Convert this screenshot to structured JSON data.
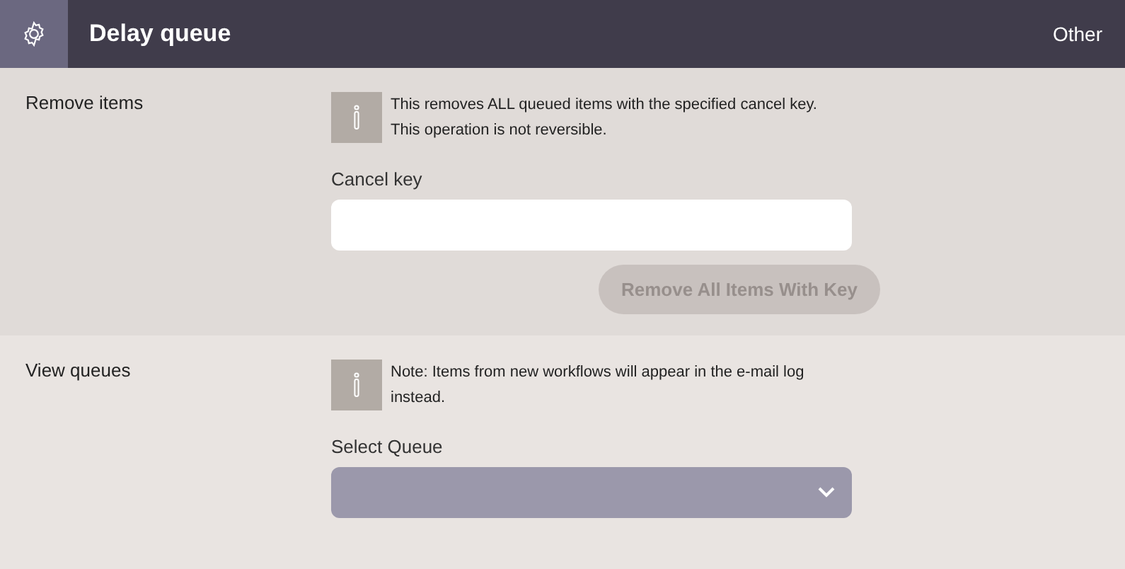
{
  "header": {
    "title": "Delay queue",
    "menu": "Other"
  },
  "sections": [
    {
      "kind": "remove",
      "label": "Remove items",
      "info": [
        "This removes ALL queued items with the specified cancel key.",
        "This operation is not reversible."
      ],
      "field_label": "Cancel key",
      "button": {
        "label": "Remove All Items With Key",
        "disabled": true
      }
    },
    {
      "kind": "view",
      "label": "View queues",
      "info": [
        "Note: Items from new workflows will appear in the e-mail log instead."
      ],
      "field_label": "Select Queue"
    }
  ]
}
